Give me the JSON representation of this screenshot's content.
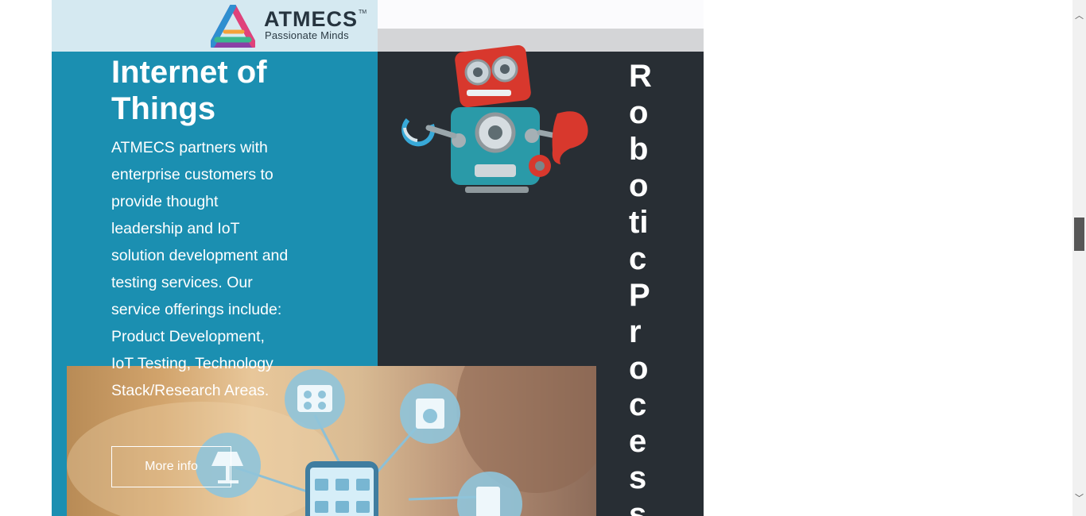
{
  "header": {
    "logo": {
      "brand": "ATMECS",
      "tagline": "Passionate Minds",
      "trademark": "TM"
    }
  },
  "iot_section": {
    "title": "Internet of Things",
    "description": "ATMECS partners with enterprise customers to provide thought leadership and IoT solution development and testing services. Our service offerings include: Product Development, IoT Testing, Technology Stack/Research Areas.",
    "button_label": "More info"
  },
  "robotics_section": {
    "title_visible": "RoboticProcess"
  },
  "icons": {
    "logo": "atmecs-logo-icon",
    "robot": "robot-illustration",
    "smart_home": "smart-home-photo",
    "scroll_up": "scroll-up-arrow-icon",
    "scroll_down": "scroll-down-arrow-icon"
  },
  "scrollbar": {
    "up_glyph": "︿",
    "down_glyph": "﹀"
  },
  "colors": {
    "iot_background": "#1b8fb1",
    "robotics_background": "#282e34",
    "logo_bar_background": "#d5e9f1",
    "text": "#ffffff"
  }
}
